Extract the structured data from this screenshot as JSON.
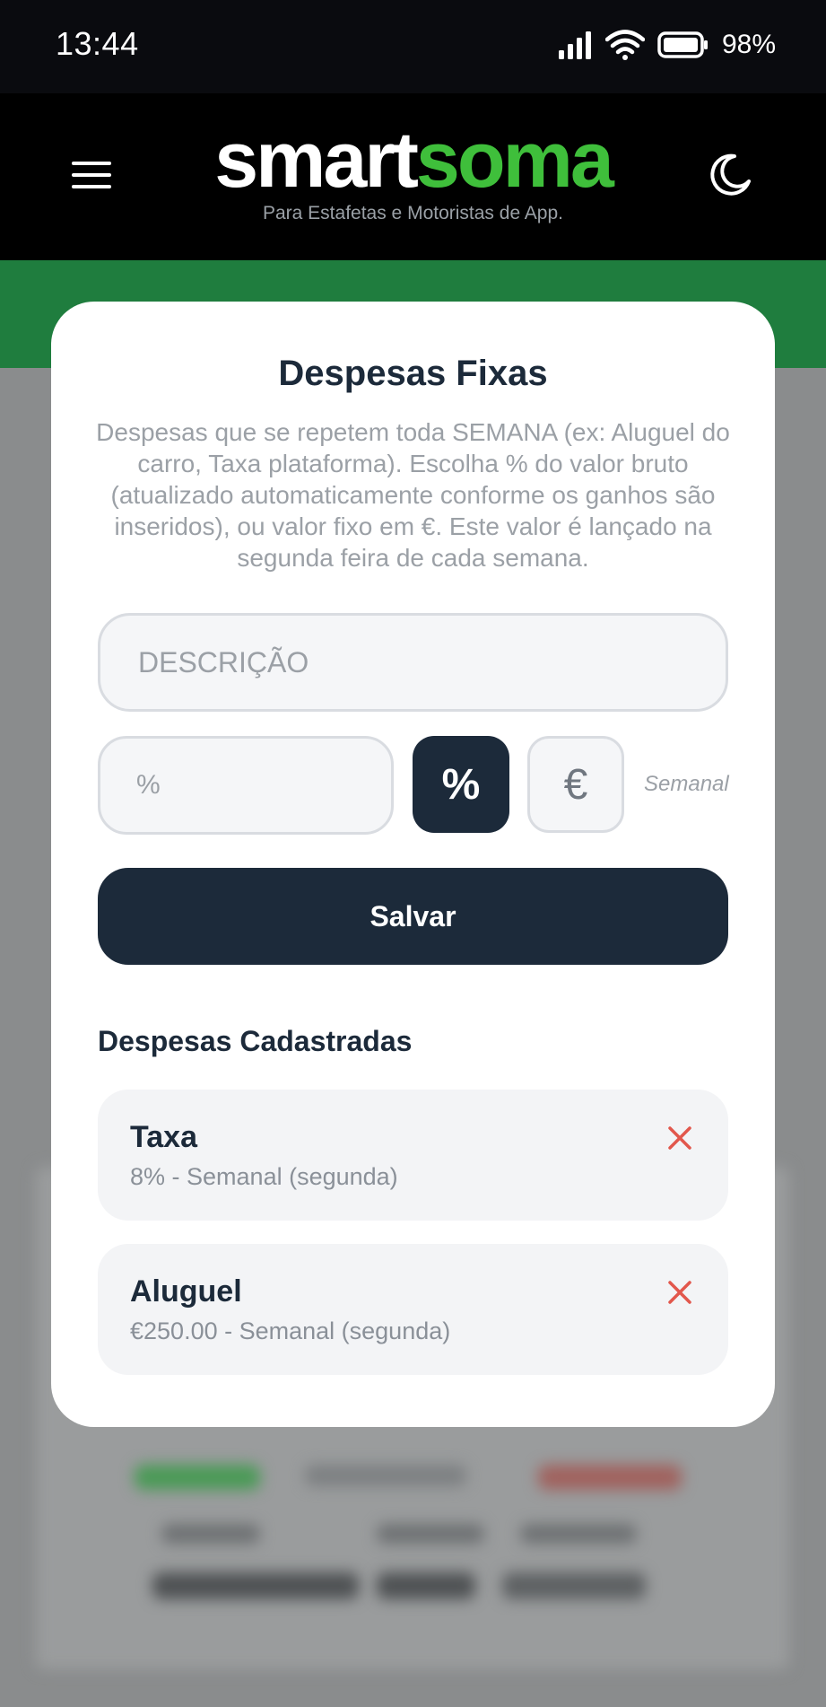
{
  "status_bar": {
    "time": "13:44",
    "battery": "98%"
  },
  "header": {
    "logo_part1": "smart",
    "logo_part2": "soma",
    "tagline": "Para Estafetas e Motoristas de App."
  },
  "modal": {
    "title": "Despesas Fixas",
    "description": "Despesas que se repetem toda SEMANA (ex: Aluguel do carro, Taxa plataforma). Escolha % do valor bruto (atualizado automaticamente conforme os ganhos são inseridos), ou valor fixo em €. Este valor é lançado na segunda feira de cada semana.",
    "description_placeholder": "DESCRIÇÃO",
    "value_placeholder": "%",
    "toggle_percent": "%",
    "toggle_euro": "€",
    "period": "Semanal",
    "save_label": "Salvar",
    "list_title": "Despesas Cadastradas",
    "expenses": [
      {
        "name": "Taxa",
        "detail": "8% - Semanal (segunda)"
      },
      {
        "name": "Aluguel",
        "detail": "€250.00 - Semanal (segunda)"
      }
    ]
  },
  "colors": {
    "brand_green": "#3fbf3b",
    "dark_navy": "#1c2a3a",
    "delete_red": "#e2574c"
  }
}
